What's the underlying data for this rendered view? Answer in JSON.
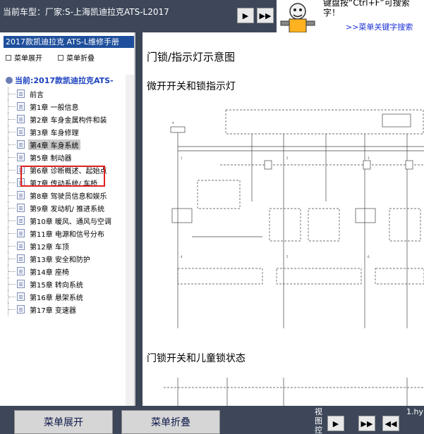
{
  "header": {
    "vehicle_title": "当前车型：厂家:S-上海凯迪拉克ATS-L2017",
    "nav_next": "▶",
    "nav_last": "▶▶"
  },
  "search_hint": {
    "text": "键盘按“Ctrl+F”可搜索 字！",
    "link": ">>菜单关键字搜索"
  },
  "sidebar": {
    "book_title": "2017款凯迪拉克  ATS-L维修手册",
    "expand_label": "菜单展开",
    "collapse_label": "菜单折叠",
    "current": "当前:2017款凯迪拉克ATS-",
    "items": [
      {
        "label": "前言"
      },
      {
        "label": "第1章  一般信息"
      },
      {
        "label": "第2章  车身金属构件和装"
      },
      {
        "label": "第3章  车身修理"
      },
      {
        "label": "第4章  车身系统"
      },
      {
        "label": "第5章  制动器"
      },
      {
        "label": "第6章  诊断概述、起始点"
      },
      {
        "label": "第7章  传动系统/ 车桥"
      },
      {
        "label": "第8章  驾驶员信息和娱乐"
      },
      {
        "label": "第9章  发动机/ 推进系统"
      },
      {
        "label": "第10章  暖风、通风与空调"
      },
      {
        "label": "第11章  电源和信号分布"
      },
      {
        "label": "第12章  车顶"
      },
      {
        "label": "第13章  安全和防护"
      },
      {
        "label": "第14章  座椅"
      },
      {
        "label": "第15章  转向系统"
      },
      {
        "label": "第16章  悬架系统"
      },
      {
        "label": "第17章  变速器"
      }
    ],
    "selected_index": 4
  },
  "content": {
    "heading": "门锁/指示灯示意图",
    "subheading": "微开开关和锁指示灯",
    "section2": "门锁开关和儿童锁状态"
  },
  "footer": {
    "expand_button": "菜单展开",
    "collapse_button": "菜单折叠",
    "view_label": "视图控",
    "nav_next": "▶",
    "nav_last": "▶▶",
    "nav_rew": "◀◀",
    "filename": "1.hy"
  },
  "colors": {
    "chrome": "#3d4759",
    "title_bar": "#1e4f9c",
    "highlight": "#e02020",
    "current_text": "#1a3fbf"
  }
}
